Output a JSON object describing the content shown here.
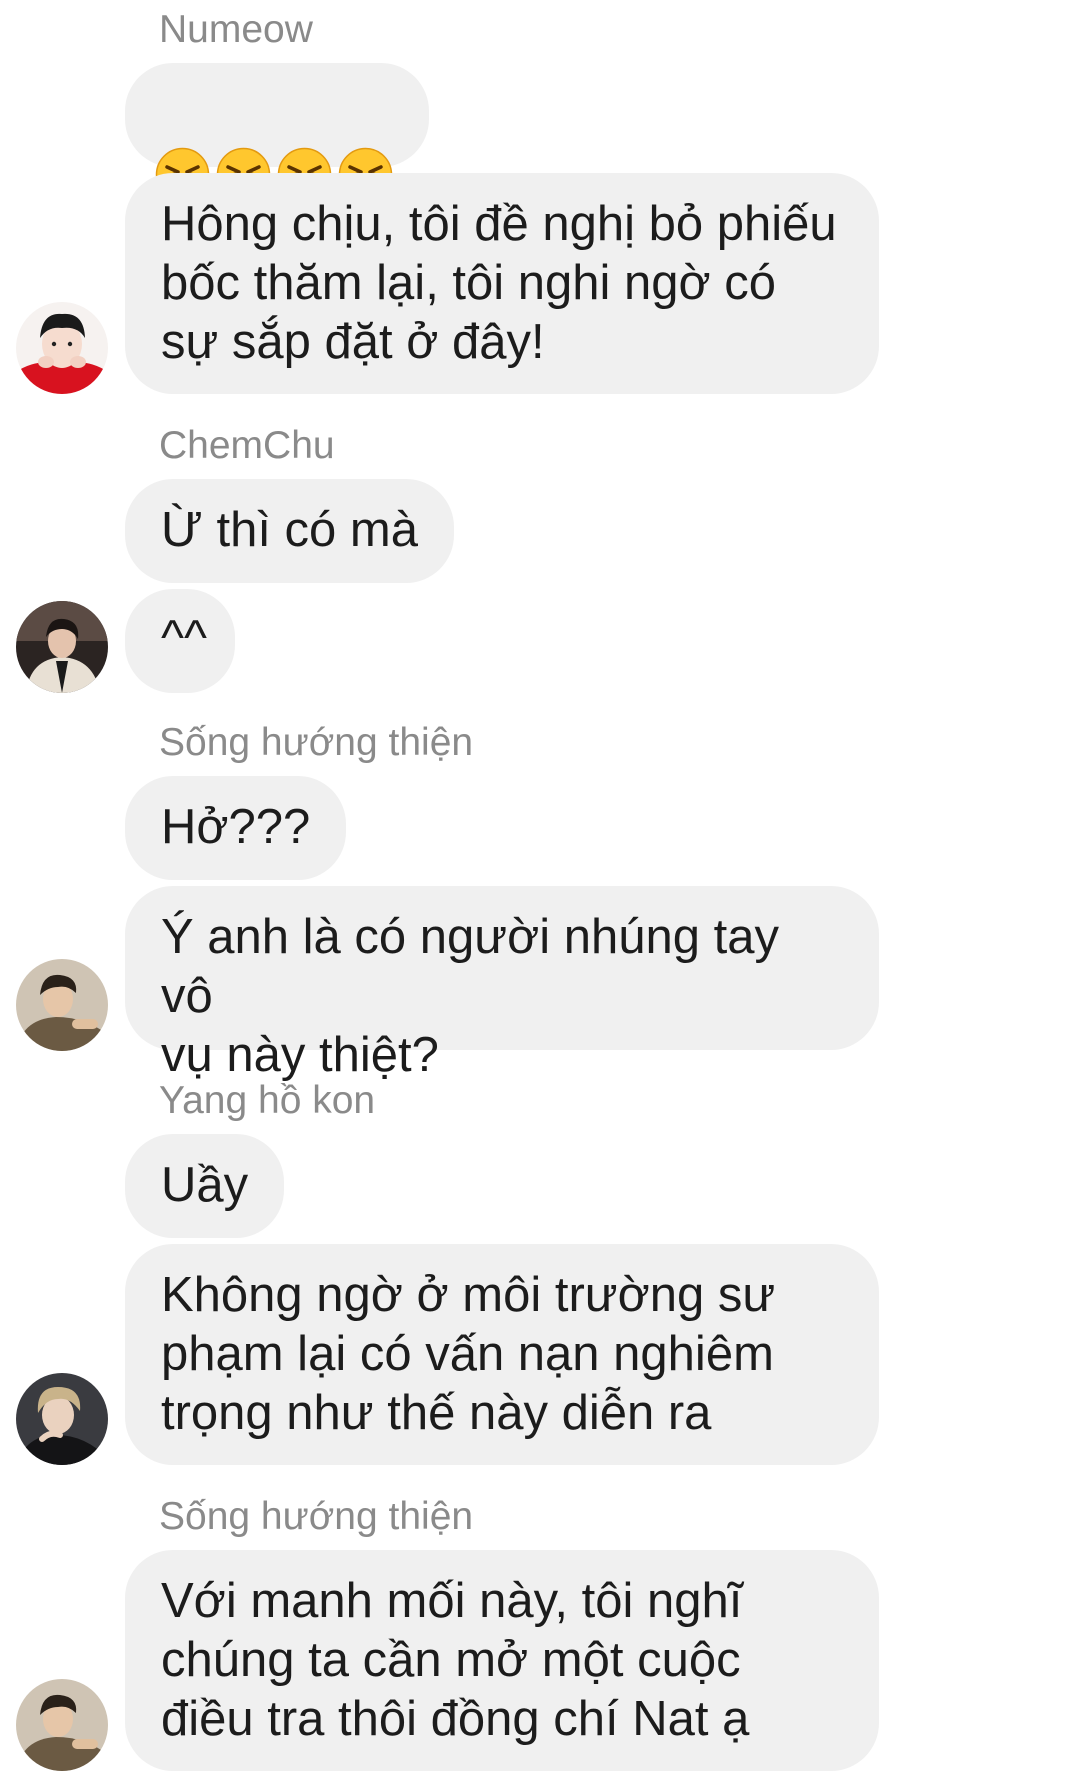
{
  "messages": [
    {
      "sender": "Numeow",
      "emoji": [
        "angry-face",
        "angry-face",
        "angry-face",
        "angry-face"
      ],
      "text": "Hông chịu, tôi đề nghị bỏ phiếu\nbốc thăm lại, tôi nghi ngờ có\nsự sắp đặt ở đây!"
    },
    {
      "sender": "ChemChu",
      "texts": [
        "Ừ thì có mà",
        "^^"
      ]
    },
    {
      "sender": "Sống hướng thiện",
      "texts": [
        "Hở???",
        "Ý anh là có người nhúng tay vô\nvụ này thiệt?"
      ]
    },
    {
      "sender": "Yang hồ kon",
      "texts": [
        "Uầy",
        "Không ngờ ở môi trường sư\nphạm lại có vấn nạn nghiêm\ntrọng như thế này diễn ra"
      ]
    },
    {
      "sender": "Sống hướng thiện",
      "texts": [
        "Với manh mối này, tôi nghĩ\nchúng ta cần mở một cuộc\nđiều tra thôi đồng chí Nat ạ"
      ]
    }
  ],
  "colors": {
    "bubble": "#f0f0f0",
    "sender_name": "#8a8a8a",
    "text": "#1c1c1c",
    "emoji_face": "#ffc72e"
  }
}
